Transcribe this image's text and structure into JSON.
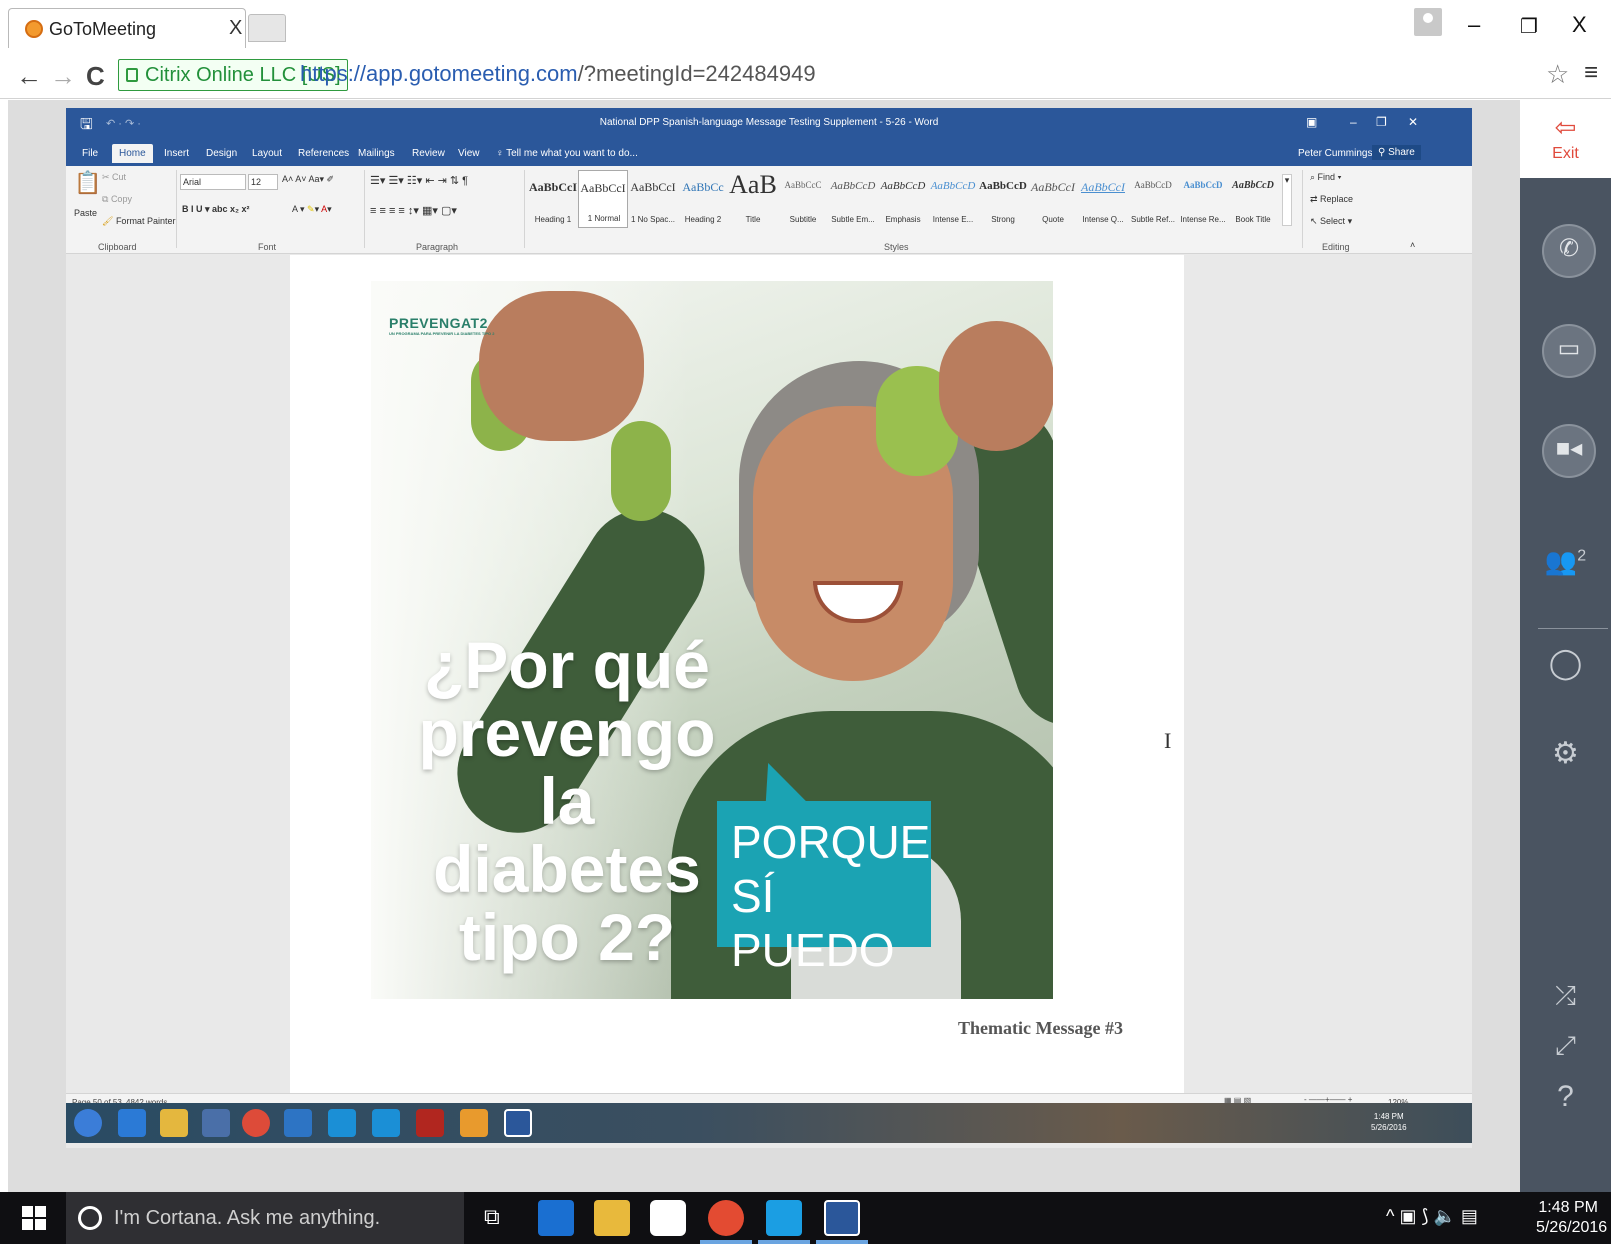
{
  "browser": {
    "tab_title": "GoToMeeting",
    "tab_close": "X",
    "security_chip": "Citrix Online LLC [US]",
    "url_scheme_host": "https://app.gotomeeting.com",
    "url_path": "/?meetingId=242484949",
    "window_minimize": "–",
    "window_restore": "❐",
    "window_close": "X",
    "star_glyph": "☆",
    "menu_glyph": "≡",
    "back_glyph": "←",
    "forward_glyph": "→",
    "reload_glyph": "C"
  },
  "word": {
    "doc_title": "National DPP Spanish-language Message Testing Supplement - 5-26 - Word",
    "tabs": [
      "File",
      "Home",
      "Insert",
      "Design",
      "Layout",
      "References",
      "Mailings",
      "Review",
      "View"
    ],
    "tell_me": "Tell me what you want to do...",
    "user": "Peter Cummings",
    "share": "Share",
    "clipboard": {
      "cut": "Cut",
      "copy": "Copy",
      "paste": "Paste",
      "format_painter": "Format Painter",
      "label": "Clipboard"
    },
    "font": {
      "name": "Arial",
      "size": "12",
      "label": "Font"
    },
    "paragraph_label": "Paragraph",
    "styles_label": "Styles",
    "styles": [
      {
        "preview": "AaBbCcI",
        "name": "Heading 1"
      },
      {
        "preview": "AaBbCcI",
        "name": "1 Normal"
      },
      {
        "preview": "AaBbCcI",
        "name": "1 No Spac..."
      },
      {
        "preview": "AaBbCc",
        "name": "Heading 2"
      },
      {
        "preview": "AaB",
        "name": "Title"
      },
      {
        "preview": "AaBbCcC",
        "name": "Subtitle"
      },
      {
        "preview": "AaBbCcD",
        "name": "Subtle Em..."
      },
      {
        "preview": "AaBbCcD",
        "name": "Emphasis"
      },
      {
        "preview": "AaBbCcD",
        "name": "Intense E..."
      },
      {
        "preview": "AaBbCcD",
        "name": "Strong"
      },
      {
        "preview": "AaBbCcI",
        "name": "Quote"
      },
      {
        "preview": "AaBbCcI",
        "name": "Intense Q..."
      },
      {
        "preview": "AaBbCcD",
        "name": "Subtle Ref..."
      },
      {
        "preview": "AaBbCcD",
        "name": "Intense Re..."
      },
      {
        "preview": "AaBbCcD",
        "name": "Book Title"
      }
    ],
    "editing": {
      "find": "Find",
      "replace": "Replace",
      "select": "Select",
      "label": "Editing"
    },
    "status": {
      "page": "Page 50 of 53",
      "words": "4842 words",
      "zoom": "120%"
    },
    "caption": "Thematic Message #3"
  },
  "poster": {
    "logo": "PREVENGAT2",
    "logo_sub": "UN PROGRAMA PARA PREVENIR LA DIABETES TIPO 2",
    "headline_lines": [
      "¿Por qué",
      "prevengo la",
      "diabetes",
      "tipo 2?"
    ],
    "bubble_lines": [
      "PORQUE",
      "SÍ PUEDO"
    ]
  },
  "remote_clock": {
    "time": "1:48 PM",
    "date": "5/26/2016"
  },
  "g2m": {
    "exit_label": "Exit",
    "attendee_count": "2"
  },
  "taskbar": {
    "cortana_placeholder": "I'm Cortana. Ask me anything.",
    "time": "1:48 PM",
    "date": "5/26/2016"
  },
  "colors": {
    "word_blue": "#2b579a",
    "g2m_panel": "#4a5461",
    "g2m_exit": "#e04a3c",
    "secure_green": "#22903a",
    "url_blue": "#2a5db0",
    "bubble_teal": "#1ba3b3"
  }
}
